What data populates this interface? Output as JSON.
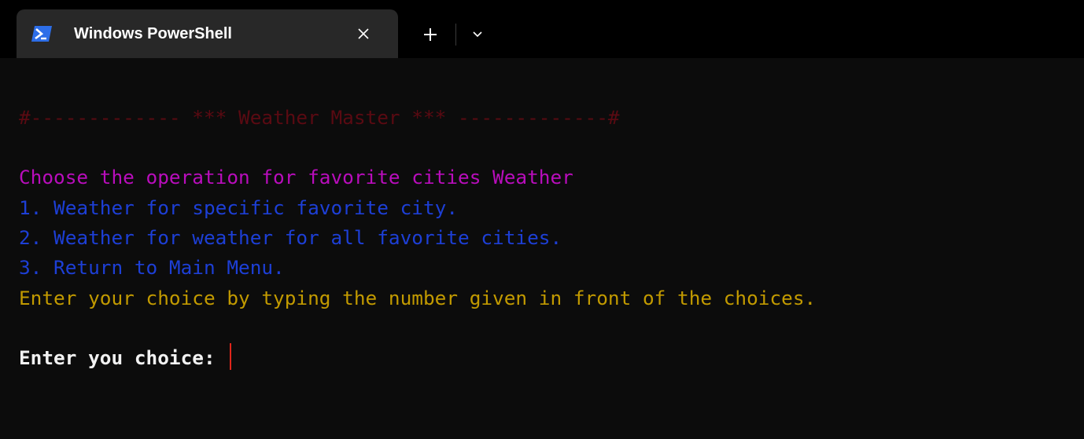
{
  "tab": {
    "title": "Windows PowerShell",
    "icon": "powershell-icon",
    "close_icon": "close-icon",
    "new_tab_icon": "plus-icon",
    "dropdown_icon": "chevron-down-icon"
  },
  "terminal": {
    "banner": "#------------- *** Weather Master *** -------------#",
    "heading": "Choose the operation for favorite cities Weather",
    "options": [
      "1. Weather for specific favorite city.",
      "2. Weather for weather for all favorite cities.",
      "3. Return to Main Menu."
    ],
    "instruction": "Enter your choice by typing the number given in front of the choices.",
    "prompt": "Enter you choice: ",
    "input_value": ""
  },
  "colors": {
    "background": "#0c0c0c",
    "tabstrip": "#000000",
    "tab": "#282828",
    "banner": "#5a0a12",
    "heading": "#b90dbc",
    "options": "#1d3fd6",
    "instruction": "#c29a00",
    "prompt": "#f2f2f2",
    "cursor": "#e0261b",
    "powershell_icon_bg": "#2d6ee8"
  }
}
